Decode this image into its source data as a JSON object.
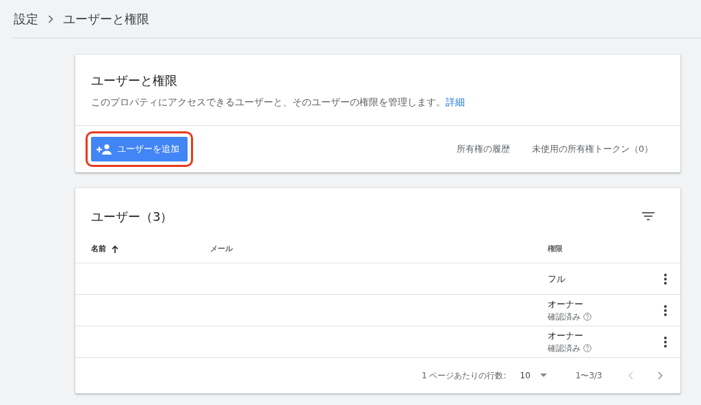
{
  "breadcrumb": [
    {
      "label": "設定"
    },
    {
      "label": "ユーザーと権限"
    }
  ],
  "intro": {
    "title": "ユーザーと権限",
    "description": "このプロパティにアクセスできるユーザーと、そのユーザーの権限を管理します。",
    "link": "詳細",
    "add_button": {
      "label": "ユーザーを追加",
      "highlighted": true
    },
    "actions": [
      {
        "label": "所有権の履歴"
      },
      {
        "label": "未使用の所有権トークン（0）"
      }
    ]
  },
  "users": {
    "title": "ユーザー（3）",
    "columns": [
      {
        "label": "名前",
        "sorted": true
      },
      {
        "label": "メール",
        "sorted": false
      },
      {
        "label": "権限",
        "sorted": false
      }
    ],
    "rows": [
      {
        "permission": "フル"
      },
      {
        "permission": "オーナー",
        "status": "確認済み"
      },
      {
        "permission": "オーナー",
        "status": "確認済み"
      }
    ],
    "pagination": {
      "rows_label": "1 ページあたりの行数:",
      "rows_per_page": "10",
      "range": "1〜3/3",
      "prev_disabled": true,
      "next_disabled": false
    }
  }
}
